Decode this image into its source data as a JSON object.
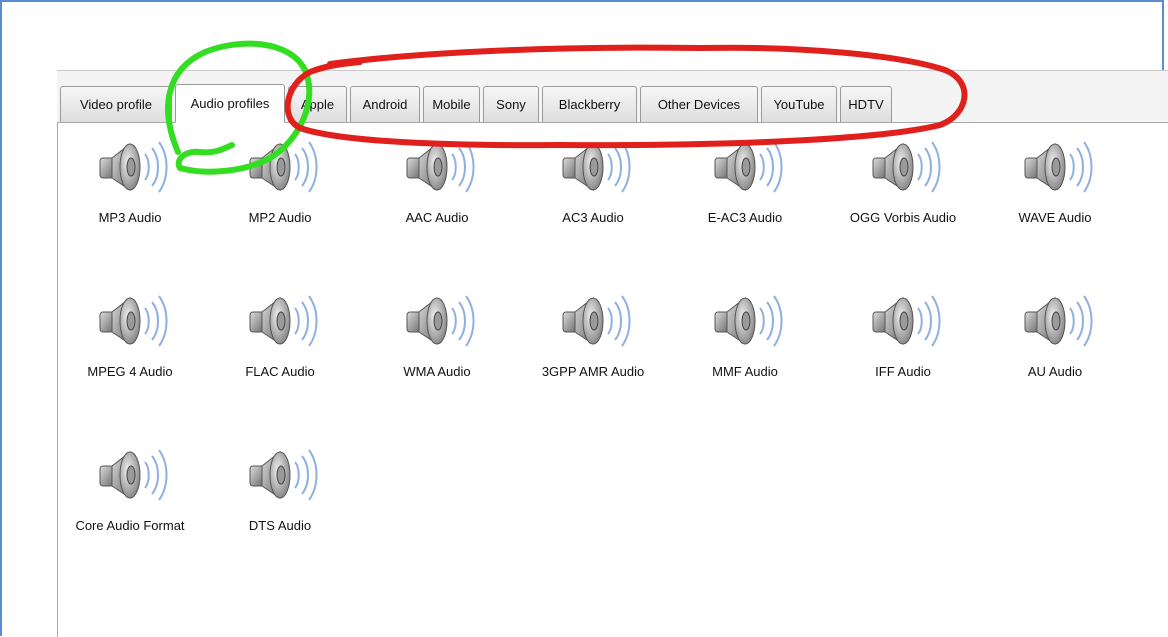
{
  "tabs": [
    {
      "label": "Video profile",
      "active": false
    },
    {
      "label": "Audio profiles",
      "active": true
    },
    {
      "label": "Apple",
      "active": false
    },
    {
      "label": "Android",
      "active": false
    },
    {
      "label": "Mobile",
      "active": false
    },
    {
      "label": "Sony",
      "active": false
    },
    {
      "label": "Blackberry",
      "active": false
    },
    {
      "label": "Other Devices",
      "active": false
    },
    {
      "label": "YouTube",
      "active": false
    },
    {
      "label": "HDTV",
      "active": false
    }
  ],
  "profiles": [
    {
      "label": "MP3 Audio",
      "icon": "speaker-icon"
    },
    {
      "label": "MP2 Audio",
      "icon": "speaker-icon"
    },
    {
      "label": "AAC Audio",
      "icon": "speaker-icon"
    },
    {
      "label": "AC3 Audio",
      "icon": "speaker-icon"
    },
    {
      "label": "E-AC3 Audio",
      "icon": "speaker-icon"
    },
    {
      "label": "OGG Vorbis Audio",
      "icon": "speaker-icon"
    },
    {
      "label": "WAVE Audio",
      "icon": "speaker-icon"
    },
    {
      "label": "MPEG 4 Audio",
      "icon": "speaker-icon"
    },
    {
      "label": "FLAC Audio",
      "icon": "speaker-icon"
    },
    {
      "label": "WMA Audio",
      "icon": "speaker-icon"
    },
    {
      "label": "3GPP AMR Audio",
      "icon": "speaker-icon"
    },
    {
      "label": "MMF Audio",
      "icon": "speaker-icon"
    },
    {
      "label": "IFF Audio",
      "icon": "speaker-icon"
    },
    {
      "label": "AU Audio",
      "icon": "speaker-icon"
    },
    {
      "label": "Core Audio Format",
      "icon": "speaker-icon"
    },
    {
      "label": "DTS Audio",
      "icon": "speaker-icon"
    }
  ],
  "colors": {
    "green_annotation": "#33dd22",
    "red_annotation": "#e0201c",
    "frame_border": "#5b8bd0"
  }
}
